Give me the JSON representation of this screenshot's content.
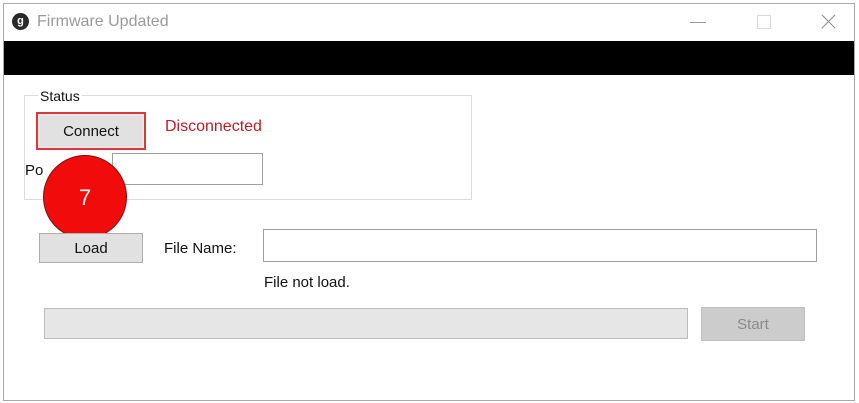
{
  "window": {
    "title": "Firmware Updated",
    "app_icon_glyph": "g"
  },
  "status_group": {
    "label": "Status",
    "connect_label": "Connect",
    "connection_status": "Disconnected",
    "port_label_partial": "Po",
    "port_value": ""
  },
  "annotation": {
    "step_number": "7"
  },
  "file": {
    "load_label": "Load",
    "name_label": "File Name:",
    "name_value": "",
    "status": "File not load."
  },
  "progress": {
    "value_percent": 0
  },
  "actions": {
    "start_label": "Start"
  },
  "colors": {
    "status_red": "#b5202a",
    "marker_red": "#f10b0b",
    "highlight_border": "#d9383f"
  }
}
